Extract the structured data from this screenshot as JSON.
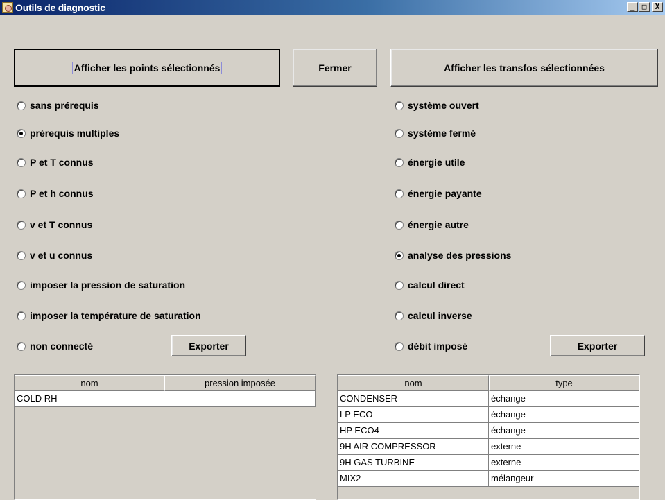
{
  "window": {
    "title": "Outils de diagnostic",
    "controls": {
      "minimize": "_",
      "maximize": "□",
      "close": "X"
    }
  },
  "buttons": {
    "show_points": "Afficher les points sélectionnés",
    "close": "Fermer",
    "show_transfos": "Afficher les transfos sélectionnées",
    "export_left": "Exporter",
    "export_right": "Exporter"
  },
  "left_options": [
    {
      "label": "sans prérequis",
      "checked": false
    },
    {
      "label": "prérequis multiples",
      "checked": true
    },
    {
      "label": "P et T connus",
      "checked": false
    },
    {
      "label": "P et h connus",
      "checked": false
    },
    {
      "label": "v et T connus",
      "checked": false
    },
    {
      "label": "v et u connus",
      "checked": false
    },
    {
      "label": "imposer la pression de saturation",
      "checked": false
    },
    {
      "label": "imposer la température de saturation",
      "checked": false
    },
    {
      "label": "non connecté",
      "checked": false
    }
  ],
  "right_options": [
    {
      "label": "système ouvert",
      "checked": false
    },
    {
      "label": "système fermé",
      "checked": false
    },
    {
      "label": "énergie utile",
      "checked": false
    },
    {
      "label": "énergie payante",
      "checked": false
    },
    {
      "label": "énergie autre",
      "checked": false
    },
    {
      "label": "analyse des pressions",
      "checked": true
    },
    {
      "label": "calcul direct",
      "checked": false
    },
    {
      "label": "calcul inverse",
      "checked": false
    },
    {
      "label": "débit imposé",
      "checked": false
    }
  ],
  "left_table": {
    "columns": [
      "nom",
      "pression imposée"
    ],
    "rows": [
      [
        "COLD RH",
        ""
      ]
    ]
  },
  "right_table": {
    "columns": [
      "nom",
      "type"
    ],
    "rows": [
      [
        "CONDENSER",
        "échange"
      ],
      [
        "LP ECO",
        "échange"
      ],
      [
        "HP ECO4",
        "échange"
      ],
      [
        "9H AIR COMPRESSOR",
        "externe"
      ],
      [
        "9H GAS TURBINE",
        "externe"
      ],
      [
        "MIX2",
        "mélangeur"
      ]
    ]
  }
}
